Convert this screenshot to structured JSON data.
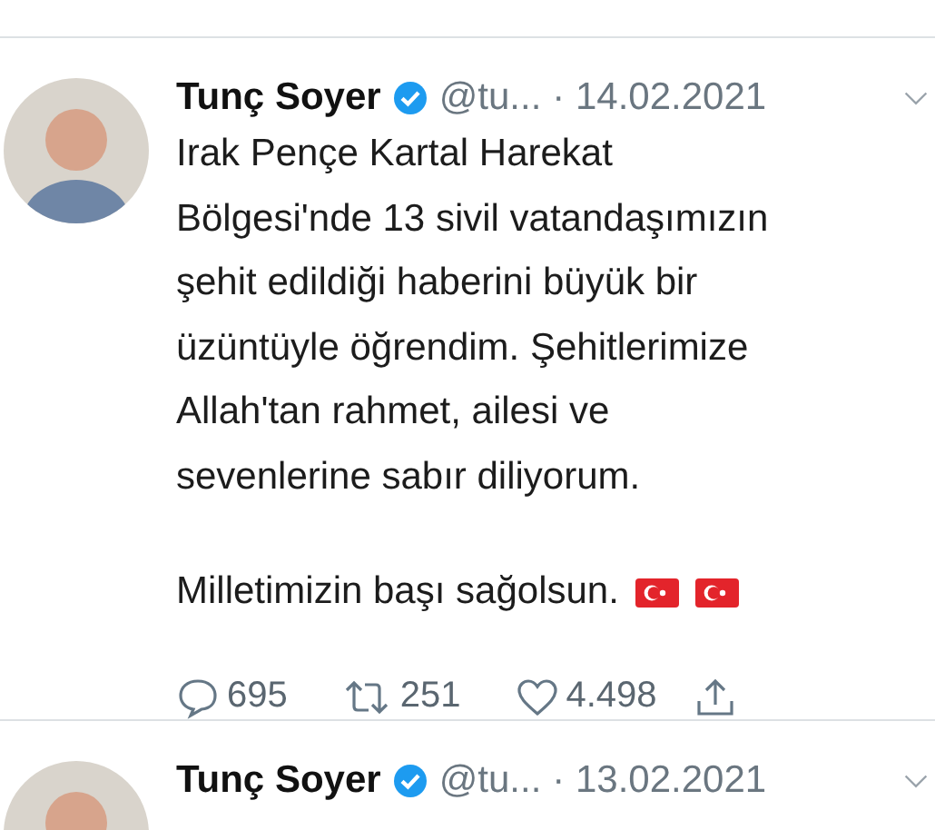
{
  "tweets": [
    {
      "name": "Tunç Soyer",
      "verified": true,
      "handle": "@tu...",
      "date": "· 14.02.2021",
      "paragraphs": [
        "Irak Pençe Kartal Harekat\nBölgesi'nde 13 sivil vatandaşımızın\nşehit edildiği haberini büyük bir\nüzüntüyle öğrendim. Şehitlerimize\nAllah'tan rahmet, ailesi ve\nsevenlerine sabır diliyorum.",
        "Milletimizin başı sağolsun."
      ],
      "emoji": [
        {
          "kind": "flag"
        },
        {
          "kind": "flag"
        }
      ],
      "replies": "695",
      "retweets": "251",
      "likes": "4.498"
    },
    {
      "name": "Tunç Soyer",
      "verified": true,
      "handle": "@tu...",
      "date": "· 13.02.2021"
    }
  ]
}
